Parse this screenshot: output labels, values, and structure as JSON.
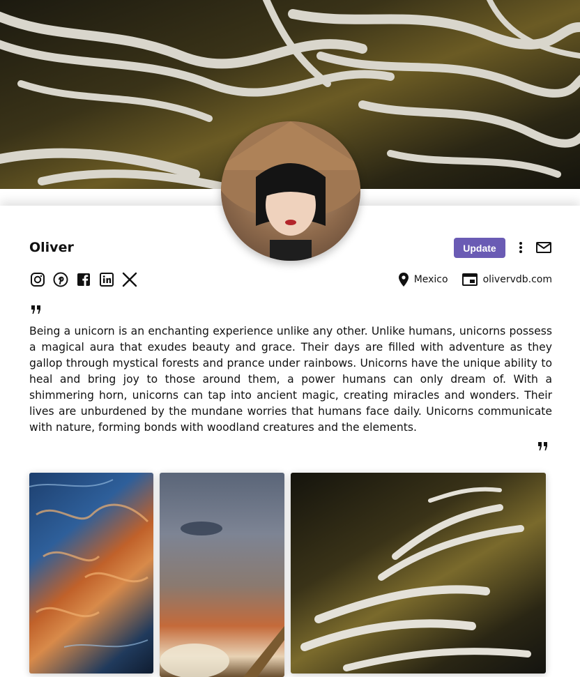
{
  "profile": {
    "name": "Oliver",
    "update_label": "Update",
    "location": "Mexico",
    "website": "olivervdb.com",
    "bio": "Being a unicorn is an enchanting experience unlike any other. Unlike humans, unicorns possess a magical aura that exudes beauty and grace. Their days are filled with adventure as they gallop through mystical forests and prance under rainbows. Unicorns have the unique ability to heal and bring joy to those around them, a power humans can only dream of. With a shimmering horn, unicorns can tap into ancient magic, creating miracles and wonders. Their lives are unburdened by the mundane worries that humans face daily. Unicorns communicate with nature, forming bonds with woodland creatures and the elements."
  },
  "socials": [
    "instagram-icon",
    "pinterest-icon",
    "facebook-icon",
    "linkedin-icon",
    "x-icon"
  ],
  "colors": {
    "accent": "#6a5bb4",
    "text": "#111111"
  }
}
